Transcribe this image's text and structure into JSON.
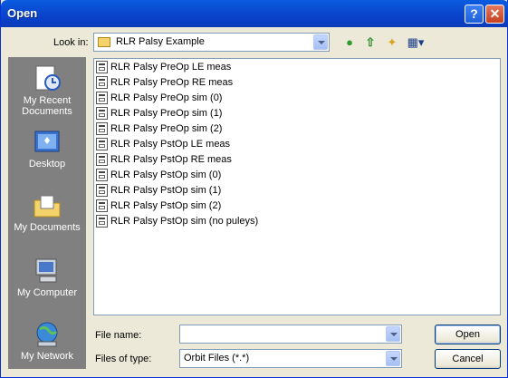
{
  "window": {
    "title": "Open",
    "help_glyph": "?",
    "close_glyph": "✕"
  },
  "lookin": {
    "label": "Look in:",
    "value": "RLR Palsy Example",
    "folder_icon": "folder-icon"
  },
  "toolbar": {
    "back_icon": "back-icon",
    "up_icon": "up-folder-icon",
    "new_icon": "new-folder-icon",
    "view_icon": "view-menu-icon",
    "back_glyph": "●",
    "up_glyph": "⇧",
    "new_glyph": "✦",
    "view_glyph": "▦▾"
  },
  "places": [
    {
      "label": "My Recent Documents",
      "icon": "recent-documents-icon"
    },
    {
      "label": "Desktop",
      "icon": "desktop-icon"
    },
    {
      "label": "My Documents",
      "icon": "my-documents-icon"
    },
    {
      "label": "My Computer",
      "icon": "my-computer-icon"
    },
    {
      "label": "My Network",
      "icon": "my-network-icon"
    }
  ],
  "files": [
    "RLR Palsy PreOp LE meas",
    "RLR Palsy PreOp RE meas",
    "RLR Palsy PreOp sim (0)",
    "RLR Palsy PreOp sim (1)",
    "RLR Palsy PreOp sim (2)",
    "RLR Palsy PstOp LE meas",
    "RLR Palsy PstOp RE meas",
    "RLR Palsy PstOp sim (0)",
    "RLR Palsy PstOp sim (1)",
    "RLR Palsy PstOp sim (2)",
    "RLR Palsy PstOp sim (no puleys)"
  ],
  "filename": {
    "label": "File name:",
    "value": ""
  },
  "filetype": {
    "label": "Files of type:",
    "value": "Orbit Files (*.*)"
  },
  "buttons": {
    "open": "Open",
    "cancel": "Cancel"
  },
  "colors": {
    "title_bar": "#0a4ad0",
    "dialog_bg": "#ece9d8",
    "places_bg": "#808080"
  }
}
